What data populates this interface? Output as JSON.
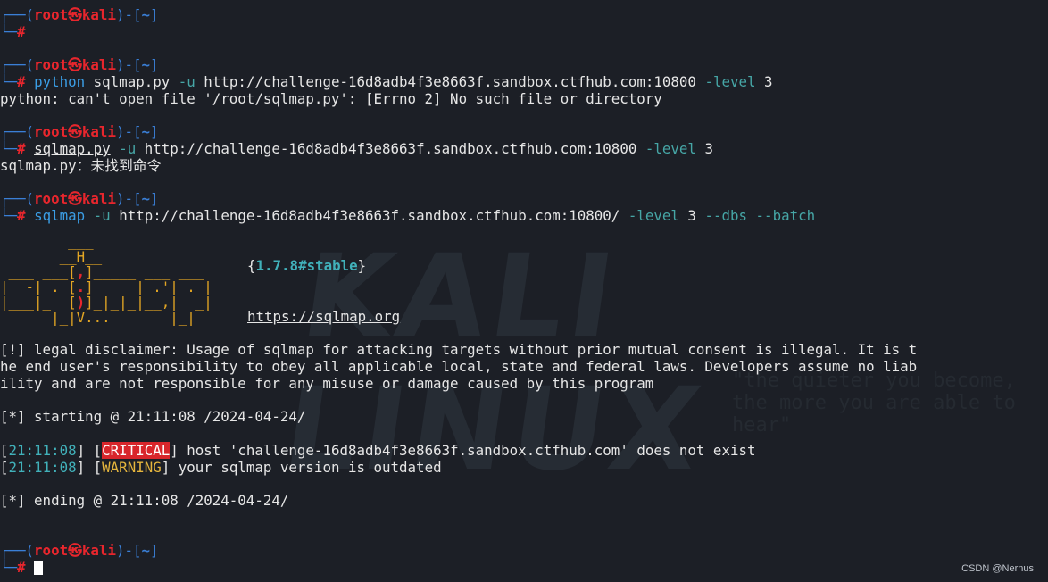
{
  "prompt": {
    "frame_top": "┌──(",
    "frame_bottom": "└─",
    "user": "root",
    "skull": "㉿",
    "host": "kali",
    "path_sep": ")-[",
    "path": "~",
    "path_end": "]",
    "hash": "#"
  },
  "commands": [
    {
      "cmd": "python",
      "args": " sqlmap.py ",
      "opt1": "-u",
      "url": " http://challenge-16d8adb4f3e8663f.sandbox.ctfhub.com:10800 ",
      "opt2": "-level",
      "tail": " 3"
    },
    {
      "cmd": "sqlmap.py",
      "args": " ",
      "opt1": "-u",
      "url": " http://challenge-16d8adb4f3e8663f.sandbox.ctfhub.com:10800 ",
      "opt2": "-level",
      "tail": " 3"
    },
    {
      "cmd": "sqlmap",
      "args": " ",
      "opt1": "-u",
      "url": " http://challenge-16d8adb4f3e8663f.sandbox.ctfhub.com:10800/ ",
      "opt2": "-level",
      "tail": " 3 ",
      "opt3": "--dbs",
      "tail2": " ",
      "opt4": "--batch"
    }
  ],
  "outputs": {
    "python_error": "python: can't open file '/root/sqlmap.py': [Errno 2] No such file or directory",
    "not_found": "sqlmap.py：未找到命令"
  },
  "banner": {
    "version": "1.7.8#stable",
    "brace_open": "{",
    "brace_close": "}",
    "url": "https://sqlmap.org"
  },
  "disclaimer": [
    "[!] legal disclaimer: Usage of sqlmap for attacking targets without prior mutual consent is illegal. It is t",
    "he end user's responsibility to obey all applicable local, state and federal laws. Developers assume no liab",
    "ility and are not responsible for any misuse or damage caused by this program"
  ],
  "starting": "[*] starting @ 21:11:08 /2024-04-24/",
  "log": [
    {
      "time": "21:11:08",
      "level": "CRITICAL",
      "message": " host 'challenge-16d8adb4f3e8663f.sandbox.ctfhub.com' does not exist"
    },
    {
      "time": "21:11:08",
      "level": "WARNING",
      "message": " your sqlmap version is outdated"
    }
  ],
  "ending": "[*] ending @ 21:11:08 /2024-04-24/",
  "background_watermark": "KALI LINUX",
  "background_tagline": "\"the quieter you become, the more you are able to hear\"",
  "csdn_watermark": "CSDN @Nernus",
  "colors": {
    "background": "#1c1f26",
    "frame": "#3a7fd6",
    "user": "#e8262d",
    "command": "#3b9ee6",
    "option": "#46a6a6",
    "timestamp": "#41b1ba",
    "critical": "#d8262b",
    "warning": "#e5b53d",
    "banner": "#e3a624"
  }
}
